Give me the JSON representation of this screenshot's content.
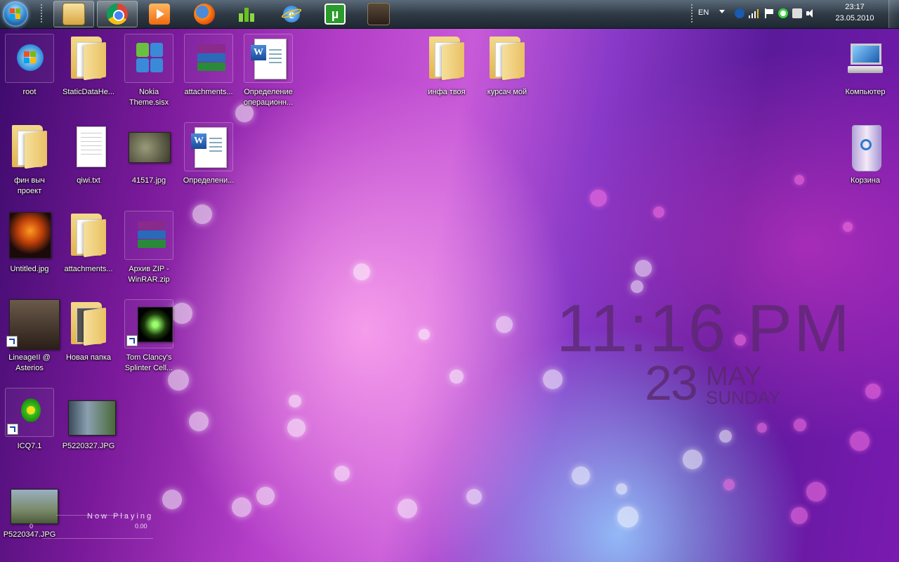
{
  "taskbar": {
    "pinned": [
      {
        "name": "explorer-icon",
        "active": true
      },
      {
        "name": "chrome-icon",
        "active": true
      },
      {
        "name": "media-player-icon",
        "active": false
      },
      {
        "name": "firefox-icon",
        "active": false
      },
      {
        "name": "green-app-icon",
        "active": false
      },
      {
        "name": "internet-explorer-icon",
        "active": false
      },
      {
        "name": "utorrent-icon",
        "active": false
      },
      {
        "name": "lineage-icon",
        "active": false
      }
    ],
    "tray": {
      "language": "EN",
      "time": "23:17",
      "date": "23.05.2010"
    }
  },
  "desktop": {
    "icons": [
      {
        "label": "root",
        "type": "app"
      },
      {
        "label": "StaticDataHe...",
        "type": "folder"
      },
      {
        "label": "Nokia Theme.sisx",
        "type": "nokia"
      },
      {
        "label": "attachments...",
        "type": "rar"
      },
      {
        "label": "Определение операционн...",
        "type": "word"
      },
      {
        "label": "инфа твоя",
        "type": "folder"
      },
      {
        "label": "курсач мой",
        "type": "folder"
      },
      {
        "label": "Компьютер",
        "type": "computer"
      },
      {
        "label": "фин выч проект",
        "type": "folder"
      },
      {
        "label": "qiwi.txt",
        "type": "txt"
      },
      {
        "label": "41517.jpg",
        "type": "photo"
      },
      {
        "label": "Определени...",
        "type": "word"
      },
      {
        "label": "Корзина",
        "type": "recycle"
      },
      {
        "label": "Untitled.jpg",
        "type": "photo"
      },
      {
        "label": "attachments...",
        "type": "folder"
      },
      {
        "label": "Архив ZIP - WinRAR.zip",
        "type": "rar"
      },
      {
        "label": "LineageII @ Asterios",
        "type": "shortcut"
      },
      {
        "label": "Новая папка",
        "type": "folder"
      },
      {
        "label": "Tom Clancy's Splinter Cell...",
        "type": "shortcut"
      },
      {
        "label": "ICQ7.1",
        "type": "shortcut"
      },
      {
        "label": "P5220327.JPG",
        "type": "photo"
      },
      {
        "label": "P5220347.JPG",
        "type": "photo"
      }
    ]
  },
  "clock_gadget": {
    "time": "11:16 PM",
    "day": "23",
    "month": "MAY",
    "weekday": "SUNDAY"
  },
  "now_playing": {
    "title": "Now Playing",
    "time": "0.00",
    "count": "0"
  }
}
